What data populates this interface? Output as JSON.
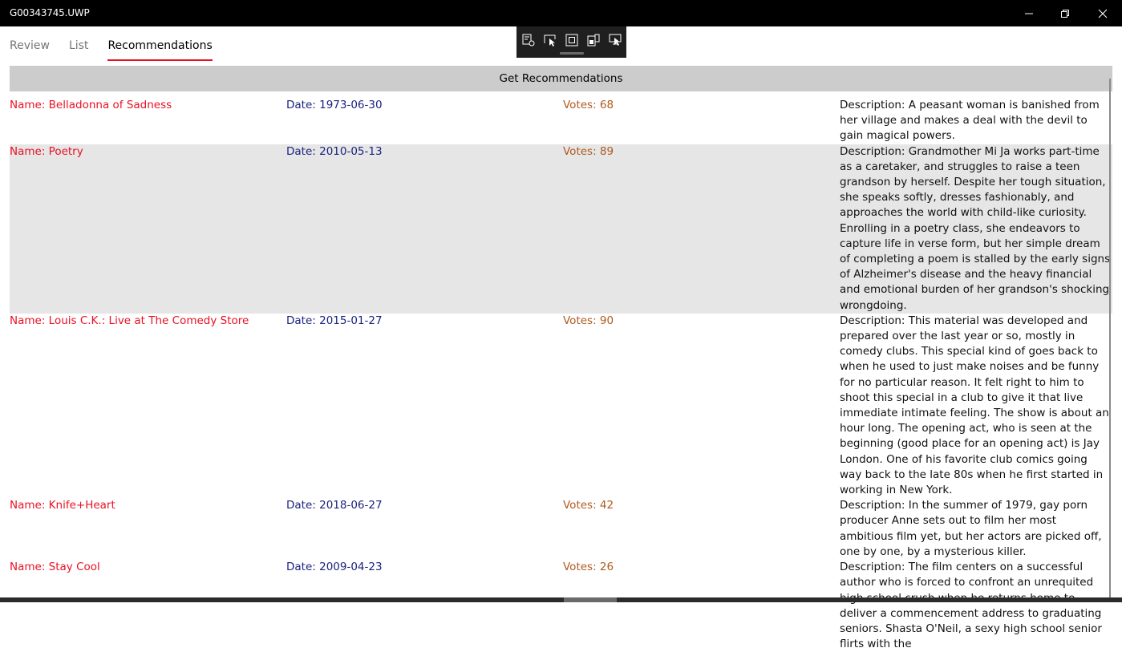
{
  "window": {
    "title": "G00343745.UWP",
    "minimize_icon": "minimize-icon",
    "restore_icon": "restore-icon",
    "close_icon": "close-icon"
  },
  "tabs": [
    {
      "label": "Review",
      "active": false
    },
    {
      "label": "List",
      "active": false
    },
    {
      "label": "Recommendations",
      "active": true
    }
  ],
  "debug_toolbar": {
    "icons": [
      "live-visual-tree-icon",
      "select-element-icon",
      "display-layout-adorners-icon",
      "track-focus-icon",
      "preview-selection-icon"
    ]
  },
  "get_button": {
    "label": "Get Recommendations"
  },
  "recommendations": [
    {
      "name": "Name: Belladonna of Sadness",
      "date": "Date: 1973-06-30",
      "votes": "Votes: 68",
      "description": "Description: A peasant woman is banished from her village and makes a deal with the devil to gain magical powers."
    },
    {
      "name": "Name: Poetry",
      "date": "Date: 2010-05-13",
      "votes": "Votes: 89",
      "description": "Description: Grandmother Mi Ja works part-time as a caretaker, and struggles to raise a teen grandson by herself. Despite her tough situation, she speaks softly, dresses fashionably, and approaches the world with child-like curiosity. Enrolling in a poetry class, she endeavors to capture life in verse form, but her simple dream of completing a poem is stalled by the early signs of Alzheimer's disease and the heavy financial and emotional burden of her grandson's shocking wrongdoing."
    },
    {
      "name": "Name: Louis C.K.: Live at The Comedy Store",
      "date": "Date: 2015-01-27",
      "votes": "Votes: 90",
      "description": "Description: This material was developed and prepared over the last year or so, mostly in comedy clubs. This special kind of goes back to when he used to just make noises and be funny for no particular reason. It felt right to him to shoot this special in a club to give it that live immediate intimate feeling. The show is about an hour long. The opening act, who is seen at the beginning (good place for an opening act) is Jay London. One of his favorite club comics going way back to the late 80s when he first started in working in New York."
    },
    {
      "name": "Name: Knife+Heart",
      "date": "Date: 2018-06-27",
      "votes": "Votes: 42",
      "description": "Description: In the summer of 1979, gay porn producer Anne sets out to film her most ambitious film yet, but her actors are picked off, one by one, by a mysterious killer."
    },
    {
      "name": "Name: Stay Cool",
      "date": "Date: 2009-04-23",
      "votes": "Votes: 26",
      "description": "Description: The film centers on a successful author who is forced to confront an unrequited high school crush when he returns home to deliver a commencement address to graduating seniors. Shasta O'Neil, a sexy high school senior flirts with the"
    }
  ]
}
